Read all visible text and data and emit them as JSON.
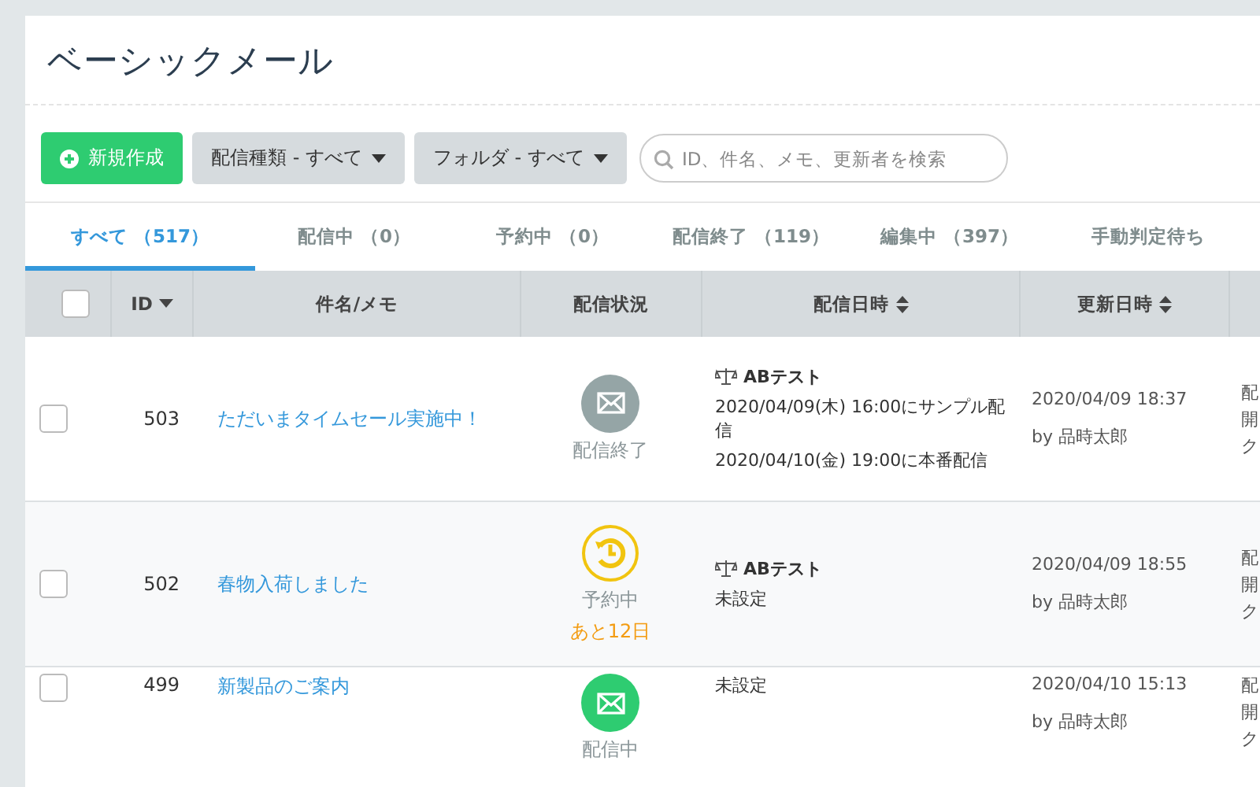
{
  "page": {
    "title": "ベーシックメール"
  },
  "toolbar": {
    "new_button": "新規作成",
    "filters": [
      {
        "label": "配信種類 - すべて"
      },
      {
        "label": "フォルダ - すべて"
      }
    ],
    "search": {
      "placeholder": "ID、件名、メモ、更新者を検索"
    }
  },
  "tabs": [
    {
      "label": "すべて （517）",
      "selected": true
    },
    {
      "label": "配信中 （0）",
      "selected": false
    },
    {
      "label": "予約中 （0）",
      "selected": false
    },
    {
      "label": "配信終了 （119）",
      "selected": false
    },
    {
      "label": "編集中 （397）",
      "selected": false
    },
    {
      "label": "手動判定待ち",
      "selected": false
    }
  ],
  "table": {
    "select_all_checked": false,
    "columns": [
      {
        "label": "ID",
        "kind": "sorted"
      },
      {
        "label": "件名/メモ",
        "kind": "plain"
      },
      {
        "label": "配信状況",
        "kind": "plain"
      },
      {
        "label": "配信日時",
        "kind": "sortable"
      },
      {
        "label": "更新日時",
        "kind": "sortable"
      }
    ],
    "rows": [
      {
        "checked": false,
        "id": "503",
        "subject": "ただいまタイムセール実施中！",
        "status": {
          "kind": "ended",
          "label": "配信終了"
        },
        "ab_test": "ABテスト",
        "schedule": [
          "2020/04/09(木) 16:00にサンプル配信",
          "2020/04/10(金) 19:00に本番配信"
        ],
        "updated": "2020/04/09 18:37",
        "updated_by": "by 品時太郎",
        "column_7": [
          "配",
          "開",
          "ク"
        ]
      },
      {
        "checked": false,
        "id": "502",
        "subject": "春物入荷しました",
        "status": {
          "kind": "scheduled",
          "label": "予約中",
          "remaining": "あと12日"
        },
        "ab_test": "ABテスト",
        "schedule": [
          "未設定"
        ],
        "updated": "2020/04/09 18:55",
        "updated_by": "by 品時太郎",
        "column_7": [
          "配",
          "開",
          "ク"
        ]
      },
      {
        "checked": false,
        "id": "499",
        "subject": "新製品のご案内",
        "status": {
          "kind": "sending",
          "label": "配信中"
        },
        "schedule": [
          "未設定"
        ],
        "updated": "2020/04/10 15:13",
        "updated_by": "by 品時太郎",
        "column_7": [
          "配",
          "開",
          "ク"
        ]
      }
    ]
  }
}
